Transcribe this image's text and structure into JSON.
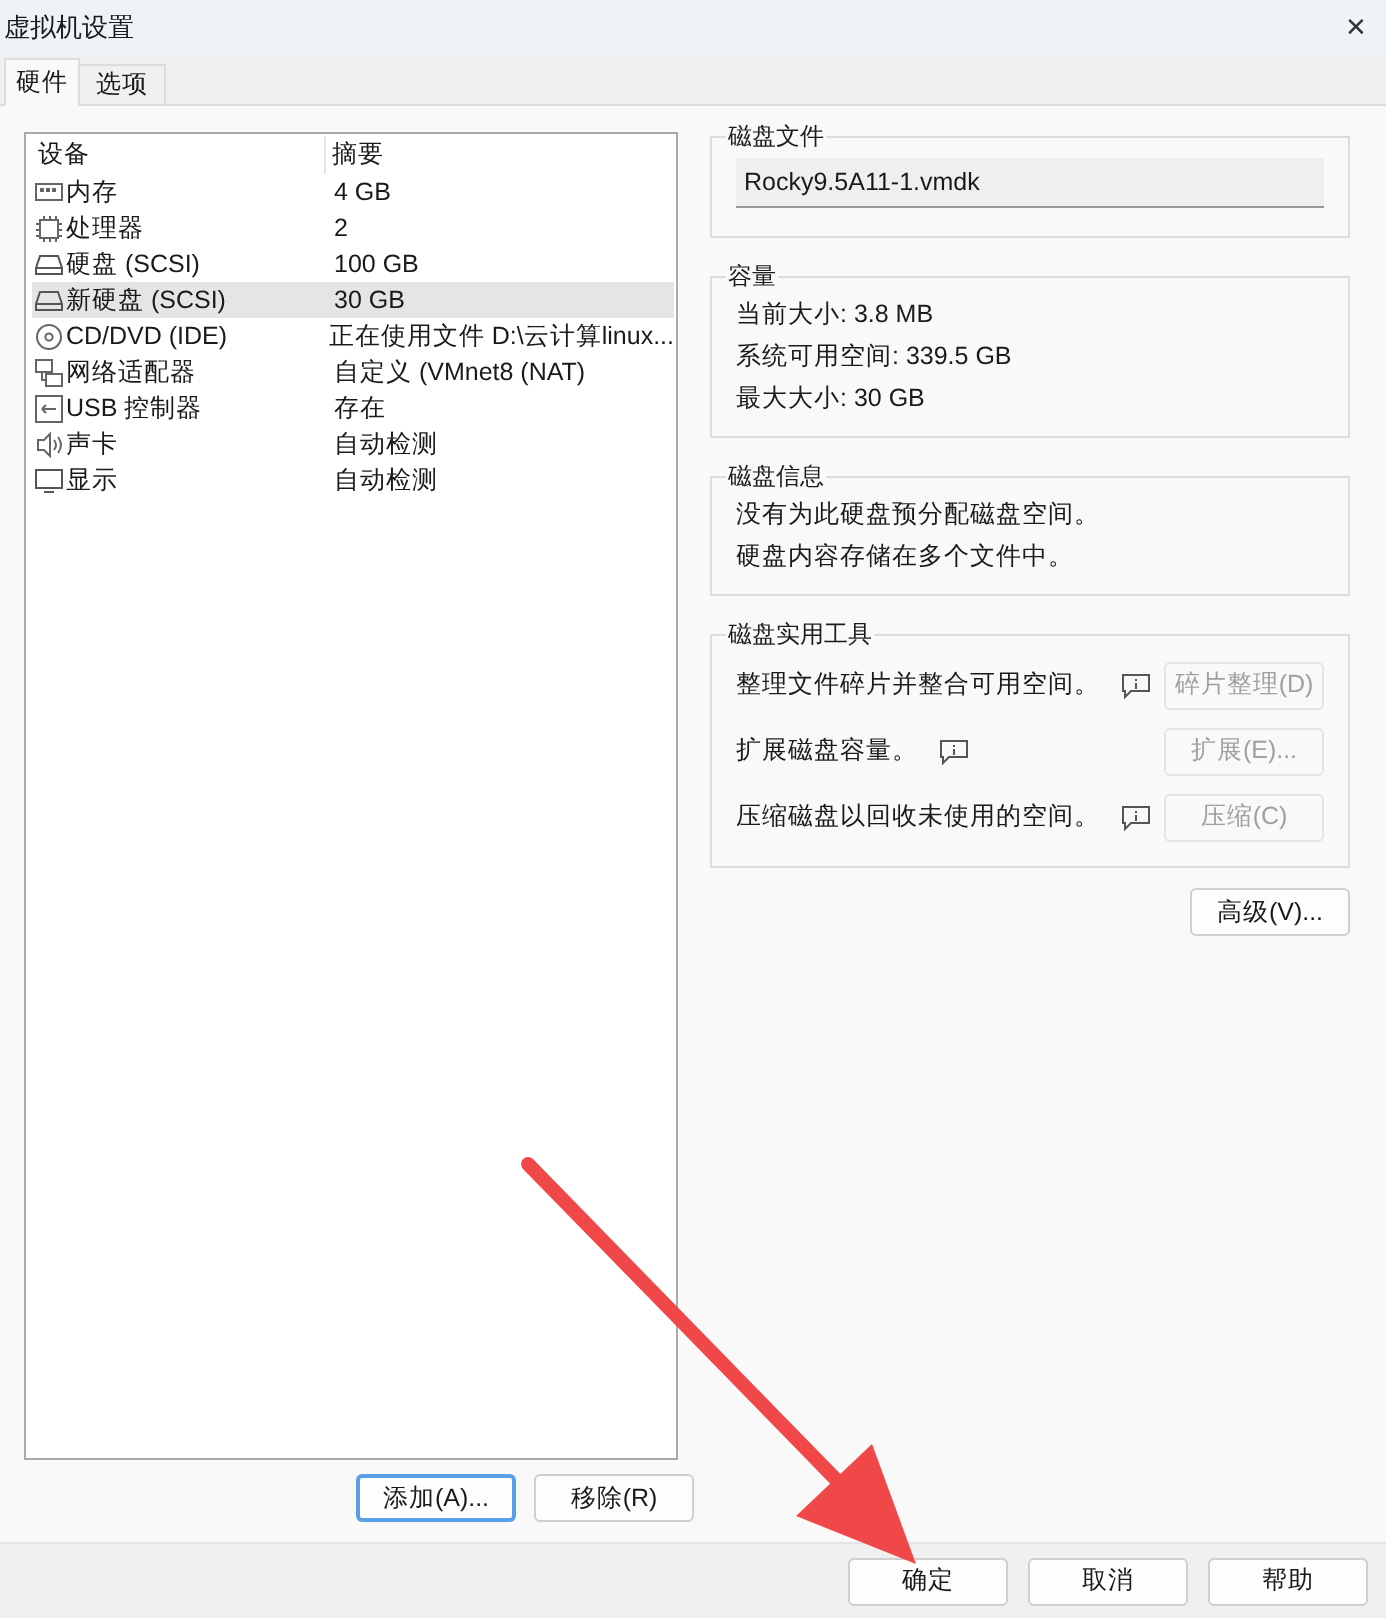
{
  "window": {
    "title": "虚拟机设置",
    "close": "✕"
  },
  "tabs": [
    {
      "label": "硬件",
      "selected": true
    },
    {
      "label": "选项",
      "selected": false
    }
  ],
  "devices": {
    "columns": [
      "设备",
      "摘要"
    ],
    "rows": [
      {
        "kind": "memory",
        "name": "内存",
        "summary": "4 GB",
        "selected": false
      },
      {
        "kind": "cpu",
        "name": "处理器",
        "summary": "2",
        "selected": false
      },
      {
        "kind": "disk",
        "name": "硬盘 (SCSI)",
        "summary": "100 GB",
        "selected": false
      },
      {
        "kind": "disk",
        "name": "新硬盘 (SCSI)",
        "summary": "30 GB",
        "selected": true
      },
      {
        "kind": "cd",
        "name": "CD/DVD (IDE)",
        "summary": "正在使用文件 D:\\云计算linux...",
        "selected": false
      },
      {
        "kind": "network",
        "name": "网络适配器",
        "summary": "自定义 (VMnet8 (NAT)",
        "selected": false
      },
      {
        "kind": "usb",
        "name": "USB 控制器",
        "summary": "存在",
        "selected": false
      },
      {
        "kind": "sound",
        "name": "声卡",
        "summary": "自动检测",
        "selected": false
      },
      {
        "kind": "display",
        "name": "显示",
        "summary": "自动检测",
        "selected": false
      }
    ],
    "buttons": [
      {
        "label": "添加(A)...",
        "focused": true
      },
      {
        "label": "移除(R)",
        "focused": false
      }
    ]
  },
  "disk_file": {
    "title": "磁盘文件",
    "value": "Rocky9.5A11-1.vmdk"
  },
  "capacity": {
    "title": "容量",
    "lines": [
      "当前大小: 3.8 MB",
      "系统可用空间: 339.5 GB",
      "最大大小: 30 GB"
    ]
  },
  "disk_info": {
    "title": "磁盘信息",
    "lines": [
      "没有为此硬盘预分配磁盘空间。",
      "硬盘内容存储在多个文件中。"
    ]
  },
  "utilities": {
    "title": "磁盘实用工具",
    "items": [
      {
        "text": "整理文件碎片并整合可用空间。",
        "button": "碎片整理(D)",
        "disabled": true
      },
      {
        "text": "扩展磁盘容量。",
        "button": "扩展(E)...",
        "disabled": true
      },
      {
        "text": "压缩磁盘以回收未使用的空间。",
        "button": "压缩(C)",
        "disabled": true
      }
    ]
  },
  "advanced_button": "高级(V)...",
  "footer_buttons": [
    "确定",
    "取消",
    "帮助"
  ]
}
